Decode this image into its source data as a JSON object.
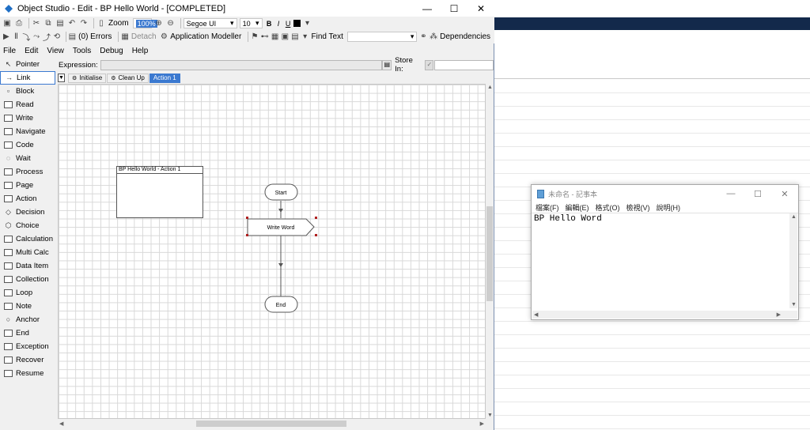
{
  "studio": {
    "title": "Object Studio  - Edit - BP Hello World - [COMPLETED]",
    "window_buttons": [
      "—",
      "☐",
      "✕"
    ],
    "toolbar1": {
      "zoom_label": "Zoom",
      "zoom_value": "100%",
      "font_name": "Segoe UI",
      "font_size": "10",
      "bold": "B",
      "italic": "I",
      "underline": "U"
    },
    "toolbar2": {
      "errors_label": "(0) Errors",
      "detach_label": "Detach",
      "app_modeller_label": "Application Modeller",
      "find_text_label": "Find Text",
      "dependencies_label": "Dependencies"
    },
    "menu": [
      "File",
      "Edit",
      "View",
      "Tools",
      "Debug",
      "Help"
    ],
    "palette": [
      {
        "label": "Pointer",
        "icon": "pointer-icon",
        "glyph": "↖"
      },
      {
        "label": "Link",
        "icon": "link-icon",
        "glyph": "→"
      },
      {
        "label": "Block",
        "icon": "block-icon",
        "glyph": "▫"
      },
      {
        "label": "Read",
        "icon": "read-icon",
        "glyph": ""
      },
      {
        "label": "Write",
        "icon": "write-icon",
        "glyph": ""
      },
      {
        "label": "Navigate",
        "icon": "navigate-icon",
        "glyph": ""
      },
      {
        "label": "Code",
        "icon": "code-icon",
        "glyph": ""
      },
      {
        "label": "Wait",
        "icon": "wait-icon",
        "glyph": "◌"
      },
      {
        "label": "Process",
        "icon": "process-icon",
        "glyph": ""
      },
      {
        "label": "Page",
        "icon": "page-icon",
        "glyph": ""
      },
      {
        "label": "Action",
        "icon": "action-icon",
        "glyph": ""
      },
      {
        "label": "Decision",
        "icon": "decision-icon",
        "glyph": "◇"
      },
      {
        "label": "Choice",
        "icon": "choice-icon",
        "glyph": "⬡"
      },
      {
        "label": "Calculation",
        "icon": "calculation-icon",
        "glyph": ""
      },
      {
        "label": "Multi Calc",
        "icon": "multi-calc-icon",
        "glyph": ""
      },
      {
        "label": "Data Item",
        "icon": "data-item-icon",
        "glyph": ""
      },
      {
        "label": "Collection",
        "icon": "collection-icon",
        "glyph": ""
      },
      {
        "label": "Loop",
        "icon": "loop-icon",
        "glyph": ""
      },
      {
        "label": "Note",
        "icon": "note-icon",
        "glyph": ""
      },
      {
        "label": "Anchor",
        "icon": "anchor-icon",
        "glyph": "○"
      },
      {
        "label": "End",
        "icon": "end-icon",
        "glyph": ""
      },
      {
        "label": "Exception",
        "icon": "exception-icon",
        "glyph": ""
      },
      {
        "label": "Recover",
        "icon": "recover-icon",
        "glyph": ""
      },
      {
        "label": "Resume",
        "icon": "resume-icon",
        "glyph": ""
      }
    ],
    "selected_palette_item": "Link",
    "expression_label": "Expression:",
    "store_in_label": "Store In:",
    "tabs": [
      {
        "label": "Initialise",
        "active": false
      },
      {
        "label": "Clean Up",
        "active": false
      },
      {
        "label": "Action 1",
        "active": true
      }
    ],
    "info_box_title": "BP Hello World - Action 1",
    "flow": {
      "start_label": "Start",
      "write_label": "Write Word",
      "end_label": "End"
    }
  },
  "notepad": {
    "title": "未命名 - 記事本",
    "menu": [
      "檔案(F)",
      "編輯(E)",
      "格式(O)",
      "檢視(V)",
      "說明(H)"
    ],
    "content": "BP Hello Word"
  },
  "colors": {
    "accent": "#3b79d0",
    "background_band": "#13294b"
  }
}
